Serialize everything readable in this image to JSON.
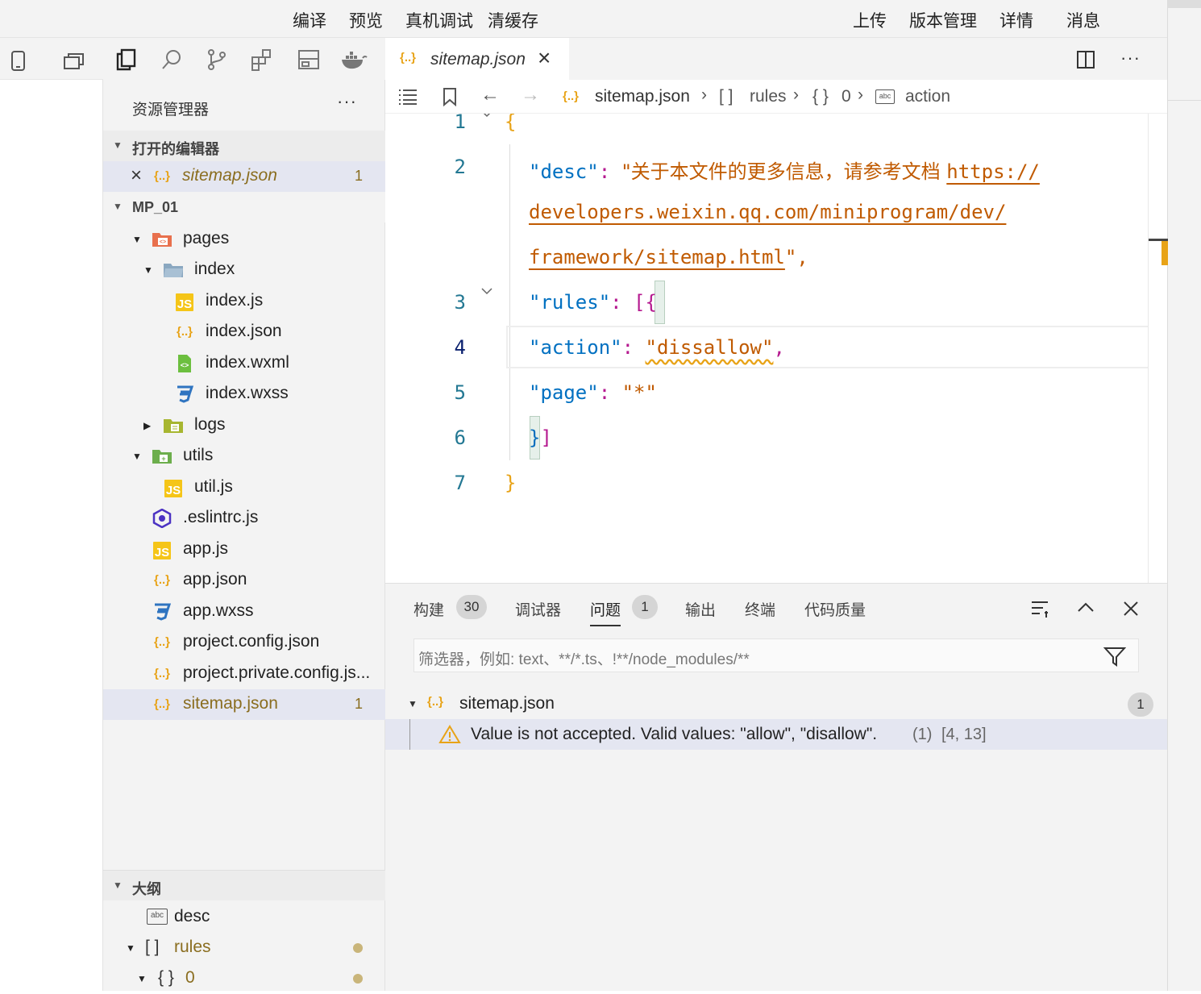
{
  "toolbar": {
    "compile": "编译",
    "preview": "预览",
    "device_debug": "真机调试",
    "clear_cache": "清缓存",
    "upload": "上传",
    "version_mgmt": "版本管理",
    "details": "详情",
    "messages": "消息"
  },
  "explorer": {
    "title": "资源管理器",
    "more": "···",
    "open_editors_label": "打开的编辑器",
    "open_editor_file": "sitemap.json",
    "open_editor_badge": "1",
    "project_label": "MP_01",
    "tree": [
      {
        "name": "pages"
      },
      {
        "name": "index"
      },
      {
        "name": "index.js"
      },
      {
        "name": "index.json"
      },
      {
        "name": "index.wxml"
      },
      {
        "name": "index.wxss"
      },
      {
        "name": "logs"
      },
      {
        "name": "utils"
      },
      {
        "name": "util.js"
      },
      {
        "name": ".eslintrc.js"
      },
      {
        "name": "app.js"
      },
      {
        "name": "app.json"
      },
      {
        "name": "app.wxss"
      },
      {
        "name": "project.config.json"
      },
      {
        "name": "project.private.config.js..."
      },
      {
        "name": "sitemap.json",
        "badge": "1"
      }
    ],
    "outline_label": "大纲",
    "outline": [
      {
        "name": "desc",
        "icon": "abc"
      },
      {
        "name": "rules",
        "icon": "[ ]"
      },
      {
        "name": "0",
        "icon": "{ }"
      }
    ]
  },
  "editor": {
    "tab_title": "sitemap.json",
    "breadcrumb": {
      "file": "sitemap.json",
      "rules_icon": "[ ]",
      "rules": "rules",
      "obj_icon": "{ }",
      "index": "0",
      "prop": "action"
    },
    "line_numbers": [
      "1",
      "2",
      "3",
      "4",
      "5",
      "6",
      "7"
    ],
    "code": {
      "open_brace": "{",
      "desc_key": "\"desc\"",
      "colon": ":",
      "desc_val_prefix": "\"关于本文件的更多信息，请参考文档 ",
      "link1": "https://",
      "link2": "developers.weixin.qq.com/miniprogram/dev/",
      "link3": "framework/sitemap.html",
      "desc_val_suffix": "\",",
      "rules_key": "\"rules\"",
      "rules_open": "[{",
      "action_key": "\"action\"",
      "action_val": "\"dissallow\"",
      "comma": ",",
      "page_key": "\"page\"",
      "page_val": "\"*\"",
      "close_obj": "}",
      "close_arr": "]",
      "close_brace": "}"
    }
  },
  "panel": {
    "tabs": [
      {
        "label": "构建",
        "badge": "30"
      },
      {
        "label": "调试器"
      },
      {
        "label": "问题",
        "badge": "1"
      },
      {
        "label": "输出"
      },
      {
        "label": "终端"
      },
      {
        "label": "代码质量"
      }
    ],
    "filter_placeholder": "筛选器，例如: text、**/*.ts、!**/node_modules/**",
    "problem_file": "sitemap.json",
    "problem_count": "1",
    "problem_message": "Value is not accepted. Valid values: \"allow\", \"disallow\".",
    "problem_code": "(1)",
    "problem_pos": "[4, 13]"
  },
  "colors": {
    "json_icon": "#e8a317",
    "key": "#0070c1",
    "string": "#c05a00",
    "warning": "#e8a317"
  }
}
